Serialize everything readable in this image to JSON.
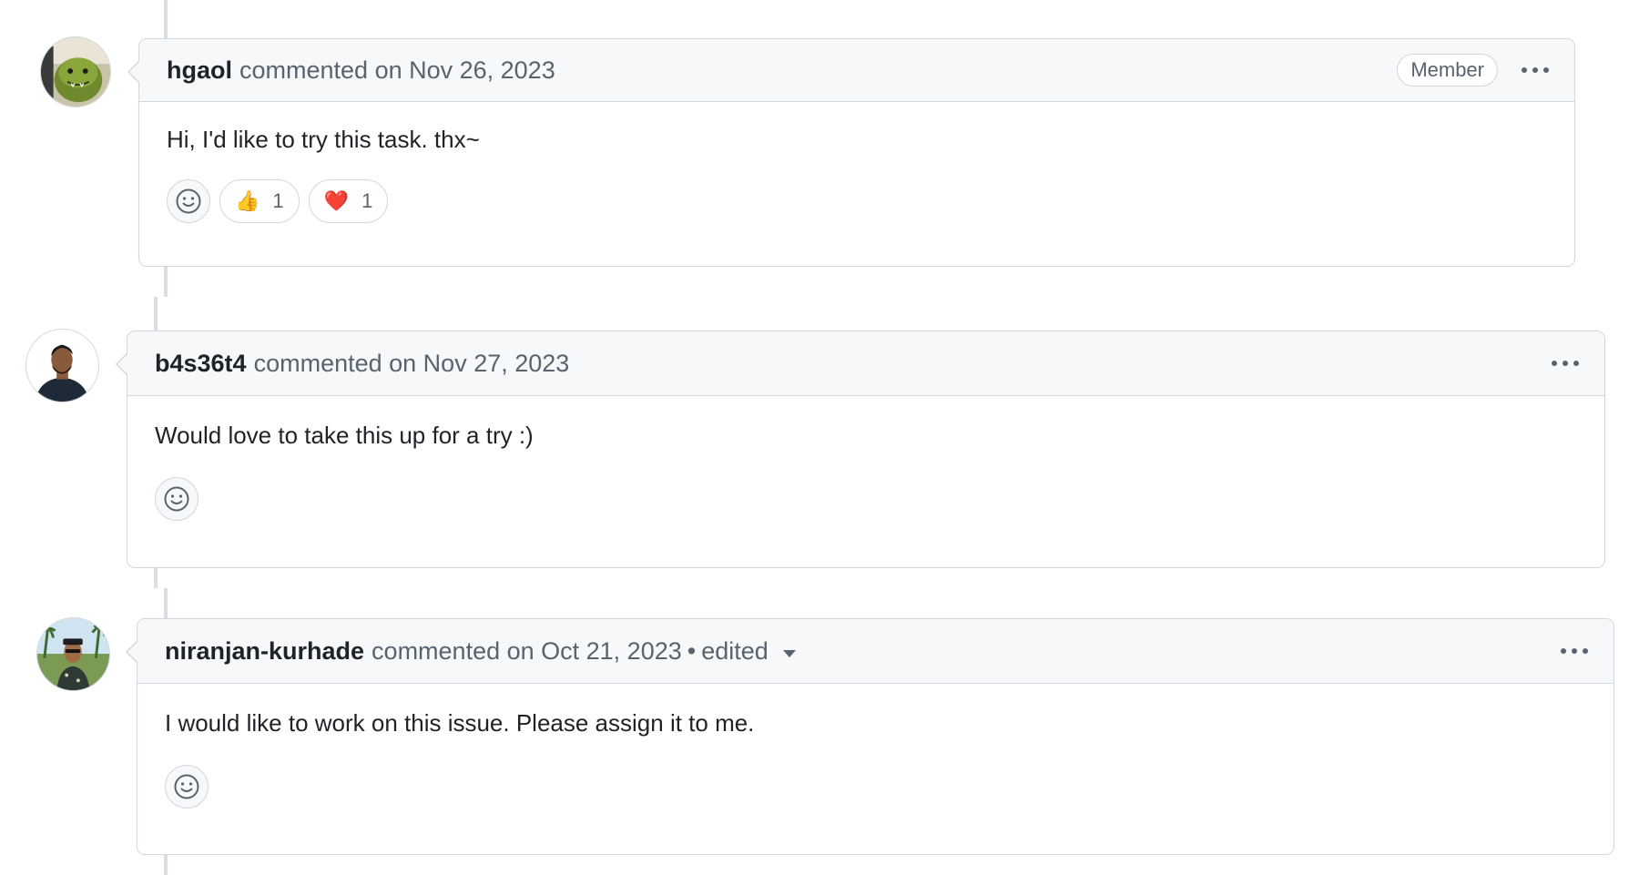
{
  "comments": [
    {
      "author": "hgaol",
      "meta": "commented on Nov 26, 2023",
      "badge": "Member",
      "body": "Hi, I'd like to try this task. thx~",
      "reactions": [
        {
          "emoji": "👍",
          "count": "1",
          "icon": "thumbs-up-icon"
        },
        {
          "emoji": "❤️",
          "count": "1",
          "icon": "heart-icon"
        }
      ]
    },
    {
      "author": "b4s36t4",
      "meta": "commented on Nov 27, 2023",
      "body": "Would love to take this up for a try :)"
    },
    {
      "author": "niranjan-kurhade",
      "meta": "commented on Oct 21, 2023",
      "dot": "•",
      "edited": "edited",
      "body": "I would like to work on this issue. Please assign it to me."
    }
  ],
  "colors": {
    "border": "#d0d7de",
    "header_bg": "#f6f8fa",
    "muted_text": "#59636e",
    "text": "#1f2328"
  }
}
